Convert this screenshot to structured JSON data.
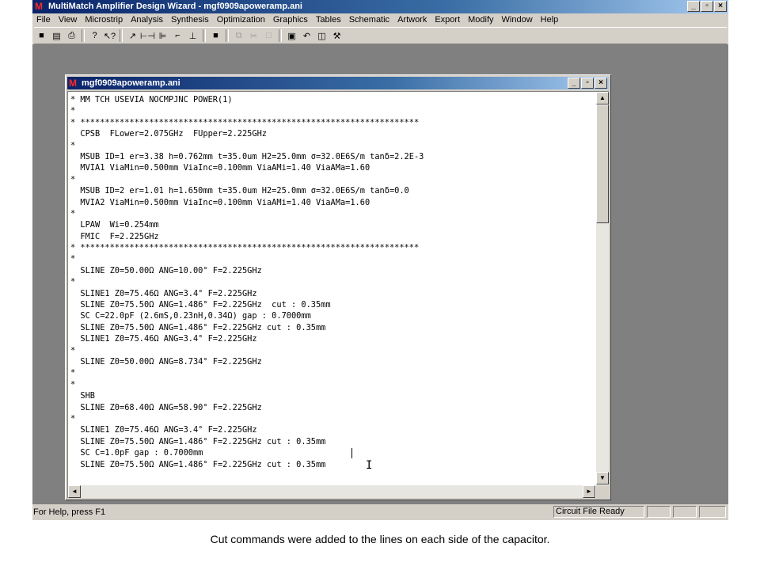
{
  "app": {
    "logo": "M",
    "title": "MultiMatch Amplifier Design Wizard - mgf0909apoweramp.ani",
    "window_buttons": [
      "_",
      "▫",
      "×"
    ]
  },
  "menu": [
    "File",
    "View",
    "Microstrip",
    "Analysis",
    "Synthesis",
    "Optimization",
    "Graphics",
    "Tables",
    "Schematic",
    "Artwork",
    "Export",
    "Modify",
    "Window",
    "Help"
  ],
  "toolbar": [
    {
      "icon": "save-icon",
      "glyph": "■"
    },
    {
      "icon": "open-icon",
      "glyph": "▤"
    },
    {
      "icon": "print-icon",
      "glyph": "⎙"
    },
    {
      "sep": true
    },
    {
      "icon": "help-icon",
      "glyph": "?"
    },
    {
      "icon": "context-help-icon",
      "glyph": "↖?"
    },
    {
      "sep": true
    },
    {
      "icon": "line-tool-icon",
      "glyph": "↗"
    },
    {
      "icon": "tool-h1-icon",
      "glyph": "⊢⊣"
    },
    {
      "icon": "tool-h2-icon",
      "glyph": "⊫"
    },
    {
      "icon": "tool-open-icon",
      "glyph": "⌐"
    },
    {
      "icon": "tool-short-icon",
      "glyph": "⊥"
    },
    {
      "sep": true
    },
    {
      "icon": "stop-icon",
      "glyph": "■"
    },
    {
      "sep": true
    },
    {
      "icon": "copy-icon",
      "glyph": "⧉",
      "disabled": true
    },
    {
      "icon": "cut-icon",
      "glyph": "✂",
      "disabled": true
    },
    {
      "icon": "clear-icon",
      "glyph": "□",
      "disabled": true
    },
    {
      "sep": true
    },
    {
      "icon": "paste-icon",
      "glyph": "▣"
    },
    {
      "icon": "undo-icon",
      "glyph": "↶"
    },
    {
      "icon": "window-icon",
      "glyph": "◫"
    },
    {
      "icon": "wrench-icon",
      "glyph": "⚒"
    }
  ],
  "document": {
    "logo": "M",
    "title": "mgf0909apoweramp.ani",
    "window_buttons": [
      "_",
      "▫",
      "×"
    ],
    "lines": [
      "* MM TCH USEVIA NOCMPJNC POWER(1)",
      "*",
      "* *********************************************************************",
      "  CPSB  FLower=2.075GHz  FUpper=2.225GHz",
      "*",
      "  MSUB ID=1 er=3.38 h=0.762mm t=35.0um H2=25.0mm σ=32.0E6S/m tanδ=2.2E-3",
      "  MVIA1 ViaMin=0.500mm ViaInc=0.100mm ViaAMi=1.40 ViaAMa=1.60",
      "*",
      "  MSUB ID=2 er=1.01 h=1.650mm t=35.0um H2=25.0mm σ=32.0E6S/m tanδ=0.0",
      "  MVIA2 ViaMin=0.500mm ViaInc=0.100mm ViaAMi=1.40 ViaAMa=1.60",
      "*",
      "  LPAW  Wi=0.254mm",
      "  FMIC  F=2.225GHz",
      "* *********************************************************************",
      "*",
      "  SLINE Z0=50.00Ω ANG=10.00° F=2.225GHz",
      "*",
      "  SLINE1 Z0=75.46Ω ANG=3.4° F=2.225GHz",
      "  SLINE Z0=75.50Ω ANG=1.486° F=2.225GHz  cut : 0.35mm",
      "  SC C=22.0pF (2.6mS,0.23nH,0.34Ω) gap : 0.7000mm",
      "  SLINE Z0=75.50Ω ANG=1.486° F=2.225GHz cut : 0.35mm",
      "  SLINE1 Z0=75.46Ω ANG=3.4° F=2.225GHz",
      "*",
      "  SLINE Z0=50.00Ω ANG=8.734° F=2.225GHz",
      "*",
      "*",
      "  SHB",
      "  SLINE Z0=68.40Ω ANG=58.90° F=2.225GHz",
      "*",
      "  SLINE1 Z0=75.46Ω ANG=3.4° F=2.225GHz",
      "  SLINE Z0=75.50Ω ANG=1.486° F=2.225GHz cut : 0.35mm",
      "  SC C=1.0pF gap : 0.7000mm",
      "  SLINE Z0=75.50Ω ANG=1.486° F=2.225GHz cut : 0.35mm"
    ]
  },
  "scroll": {
    "up": "▲",
    "down": "▼",
    "left": "◄",
    "right": "►"
  },
  "status": {
    "help": "For Help, press F1",
    "file_state": "Circuit File Ready"
  },
  "caption": "Cut commands were added to the lines on each side of the capacitor."
}
